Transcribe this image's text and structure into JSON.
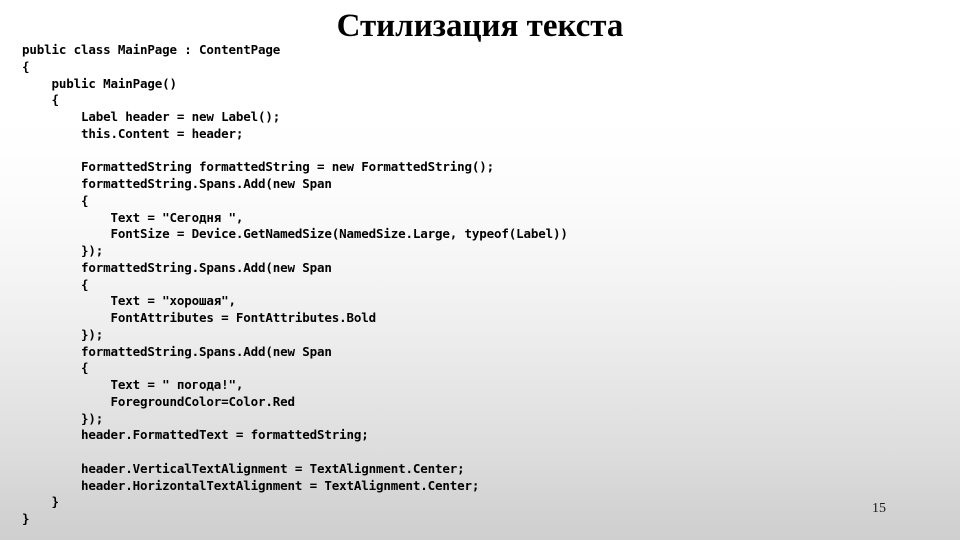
{
  "slide": {
    "title": "Стилизация текста",
    "page_number": "15",
    "background": {
      "top_color": "#ffffff",
      "bottom_color": "#cfcfcf"
    },
    "text_color": "#000000"
  },
  "code": {
    "language": "csharp",
    "lines": [
      "public class MainPage : ContentPage",
      "{",
      "    public MainPage()",
      "    {",
      "        Label header = new Label();",
      "        this.Content = header;",
      "",
      "        FormattedString formattedString = new FormattedString();",
      "        formattedString.Spans.Add(new Span",
      "        {",
      "            Text = \"Сегодня \",",
      "            FontSize = Device.GetNamedSize(NamedSize.Large, typeof(Label))",
      "        });",
      "        formattedString.Spans.Add(new Span",
      "        {",
      "            Text = \"хорошая\",",
      "            FontAttributes = FontAttributes.Bold",
      "        });",
      "        formattedString.Spans.Add(new Span",
      "        {",
      "            Text = \" погода!\",",
      "            ForegroundColor=Color.Red",
      "        });",
      "        header.FormattedText = formattedString;",
      "",
      "        header.VerticalTextAlignment = TextAlignment.Center;",
      "        header.HorizontalTextAlignment = TextAlignment.Center;",
      "    }",
      "}"
    ]
  }
}
